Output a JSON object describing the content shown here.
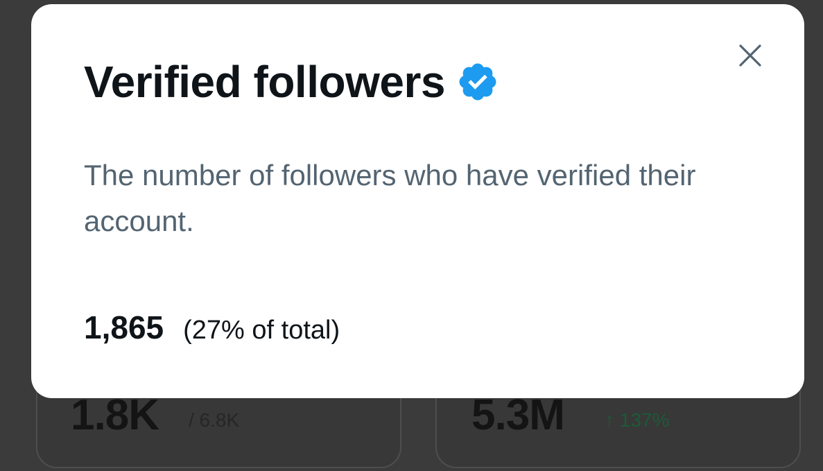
{
  "background_cards": [
    {
      "value": "1.8K",
      "subtext": "/ 6.8K"
    },
    {
      "value": "5.3M",
      "subtext": "↑ 137%",
      "subtext_color": "#1d5a38"
    }
  ],
  "modal": {
    "title": "Verified followers",
    "badge_icon": "verified-badge-icon",
    "badge_color": "#1d9bf0",
    "description": "The number of followers who have verified their account.",
    "stat_value": "1,865",
    "stat_percentage": "(27% of total)",
    "close_icon": "close-icon"
  }
}
